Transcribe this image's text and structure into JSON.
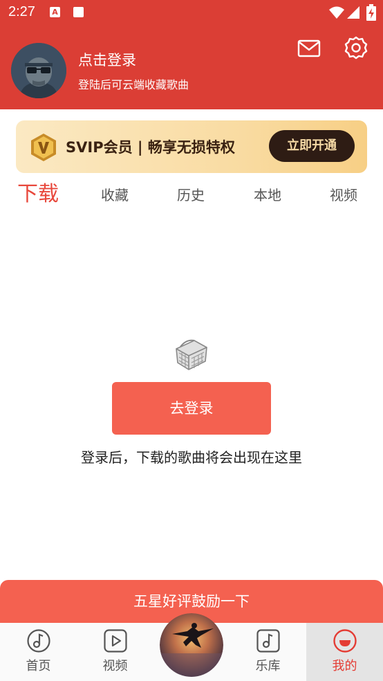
{
  "status_bar": {
    "time": "2:27",
    "notif_a": "A"
  },
  "header": {
    "login_title": "点击登录",
    "login_subtitle": "登陆后可云端收藏歌曲"
  },
  "vip": {
    "text": "SVIP会员 | 畅享无损特权",
    "button": "立即开通"
  },
  "tabs": [
    {
      "label": "下载",
      "active": true
    },
    {
      "label": "收藏"
    },
    {
      "label": "历史"
    },
    {
      "label": "本地"
    },
    {
      "label": "视频"
    }
  ],
  "empty_state": {
    "button": "去登录",
    "message": "登录后，下载的歌曲将会出现在这里"
  },
  "rate_bar": {
    "label": "五星好评鼓励一下"
  },
  "bottom_nav": [
    {
      "label": "首页",
      "icon": "music-note-circle-icon"
    },
    {
      "label": "视频",
      "icon": "play-square-icon"
    },
    {
      "label": "乐库",
      "icon": "music-note-square-icon"
    },
    {
      "label": "我的",
      "icon": "profile-active-icon",
      "active": true
    }
  ],
  "colors": {
    "header": "#db3e35",
    "accent": "#e8483c",
    "button": "#f46150",
    "vip_button": "#2e1c14"
  }
}
